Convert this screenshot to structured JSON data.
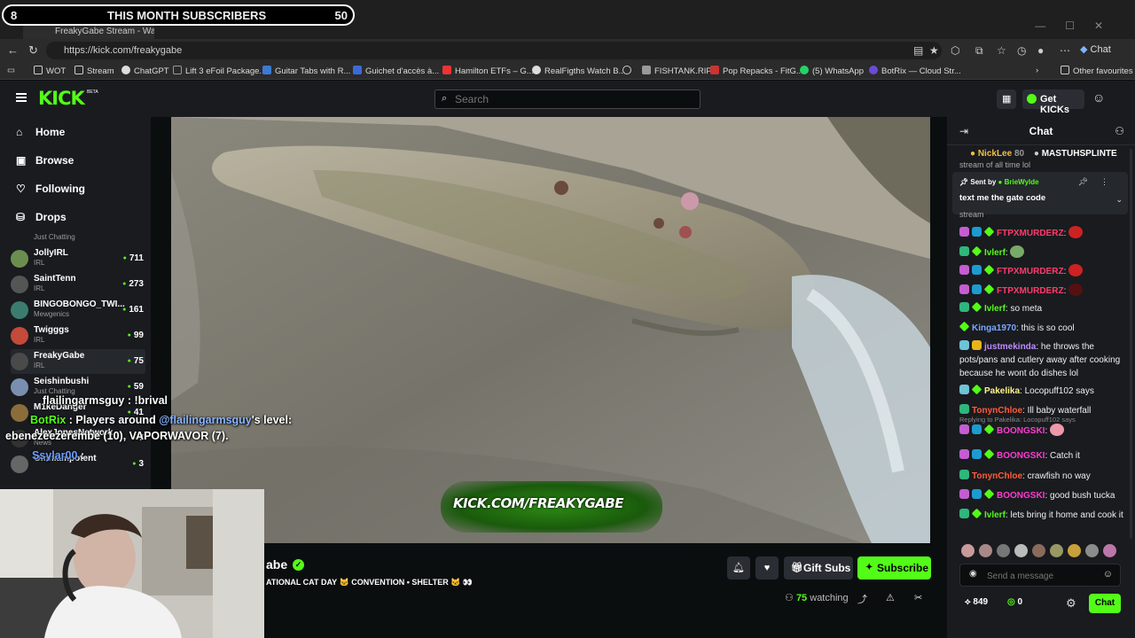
{
  "overlay_counter": {
    "count": "8",
    "title": "THIS MONTH SUBSCRIBERS",
    "value": "50"
  },
  "browser": {
    "tab_title": "FreakyGabe Stream - Watch",
    "url": "https://kick.com/freakygabe",
    "copilot_label": "Chat",
    "bookmarks": [
      "WOT",
      "Stream",
      "ChatGPT",
      "Lift 3 eFoil Package...",
      "Guitar Tabs with R...",
      "Guichet d'accès à...",
      "Hamilton ETFs – G...",
      "RealFigths Watch B...",
      "FISHTANK.RIP",
      "Pop Repacks - FitG...",
      "(5) WhatsApp",
      "BotRix — Cloud Str..."
    ],
    "other_favourites": "Other favourites"
  },
  "kick": {
    "logo": "KICK",
    "beta": "BETA",
    "search_placeholder": "Search",
    "get_kicks": "Get KICKs"
  },
  "sidebar": {
    "nav": [
      "Home",
      "Browse",
      "Following",
      "Drops"
    ],
    "top_category": "Just Chatting",
    "channels": [
      {
        "name": "JollyIRL",
        "category": "IRL",
        "viewers": "711",
        "color": "#6b8e4e"
      },
      {
        "name": "SaintTenn",
        "category": "IRL",
        "viewers": "273",
        "color": "#555"
      },
      {
        "name": "BINGOBONGO_TWI...",
        "category": "Mewgenics",
        "viewers": "161",
        "color": "#3a7d6f"
      },
      {
        "name": "Twigggs",
        "category": "IRL",
        "viewers": "99",
        "color": "#c44a3a"
      },
      {
        "name": "FreakyGabe",
        "category": "IRL",
        "viewers": "75",
        "color": "#4a4a4a"
      },
      {
        "name": "Seishinbushi",
        "category": "Just Chatting",
        "viewers": "59",
        "color": "#7a8fb0"
      },
      {
        "name": "M1keDanger",
        "category": "",
        "viewers": "41",
        "color": "#8a6d3b"
      },
      {
        "name": "AlexJonesNetwork",
        "category": "News",
        "viewers": "7",
        "color": "#333"
      },
      {
        "name": "Omniampotent",
        "category": "",
        "viewers": "3",
        "color": "#666"
      }
    ]
  },
  "overlay_chat": {
    "line1_user": "flailingarmsguy",
    "line1_msg": " : !brival",
    "line2_user": "BotRix",
    "line2_msg": " : Players around ",
    "line2_mention": "@flailingarmsguy",
    "line2_end": "'s level:",
    "line3": "ebenezeezerembe (10), VAPORWAVOR (7).",
    "line4_user": "Ssylar00",
    "line4_msg": " :"
  },
  "video": {
    "watermark": "KICK.COM/FREAKYGABE"
  },
  "stream": {
    "title": "abe",
    "subtitle": "ATIONAL CAT DAY 🐱 CONVENTION • SHELTER 🐱 👀",
    "gift_subs": "Gift Subs",
    "subscribe": "Subscribe",
    "viewers": "75",
    "watching": "watching"
  },
  "chat": {
    "title": "Chat",
    "top_gifter_1": "NickLee",
    "top_gifter_1_count": "80",
    "top_gifter_2": "MASTUHSPLINTE",
    "partial_top": "stream of all time lol",
    "pinned_by_label": "Sent by",
    "pinned_by_user": "BrieWylde",
    "pinned_message": "text me the gate code",
    "partial_pinned": "stream",
    "messages": [
      {
        "user": "FTPXMURDERZ",
        "color": "#ff3b6b",
        "text": "",
        "badges": [
          "b-sub-pink",
          "b-mod",
          "b-vip"
        ],
        "emote": "#c22"
      },
      {
        "user": "Ivlerf",
        "color": "#53fc18",
        "text": "",
        "badges": [
          "b-sub-green",
          "b-vip"
        ],
        "emote": "#7a6"
      },
      {
        "user": "FTPXMURDERZ",
        "color": "#ff3b6b",
        "text": "",
        "badges": [
          "b-sub-pink",
          "b-mod",
          "b-vip"
        ],
        "emote": "#c22"
      },
      {
        "user": "FTPXMURDERZ",
        "color": "#ff3b6b",
        "text": "",
        "badges": [
          "b-sub-pink",
          "b-mod",
          "b-vip"
        ],
        "emote": "#511"
      },
      {
        "user": "Ivlerf",
        "color": "#53fc18",
        "text": "so meta",
        "badges": [
          "b-sub-green",
          "b-vip"
        ]
      },
      {
        "user": "Kinga1970",
        "color": "#7aa8ff",
        "text": "this is so cool",
        "badges": [
          "b-vip"
        ]
      },
      {
        "user": "justmekinda",
        "color": "#c08cff",
        "text": "he throws the pots/pans and cutlery away after cooking because he wont do dishes lol",
        "badges": [
          "b-og",
          "b-gold"
        ]
      },
      {
        "user": "Pakelika",
        "color": "#fff58a",
        "text": "Locopuff102 says",
        "badges": [
          "b-og",
          "b-vip"
        ]
      },
      {
        "user": "TonynChloe",
        "color": "#ff5c3b",
        "text": "Ill baby waterfall",
        "badges": [
          "b-sub-green"
        ]
      },
      {
        "user": "BOONGSKI",
        "color": "#ff3bd1",
        "text": "",
        "badges": [
          "b-sub-pink",
          "b-mod",
          "b-vip"
        ],
        "emote": "#e9a",
        "reply": "Replying to Pakelika: Locopuff102 says"
      },
      {
        "user": "BOONGSKI",
        "color": "#ff3bd1",
        "text": "Catch it",
        "badges": [
          "b-sub-pink",
          "b-mod",
          "b-vip"
        ]
      },
      {
        "user": "TonynChloe",
        "color": "#ff5c3b",
        "text": "crawfish no way",
        "badges": [
          "b-sub-green"
        ]
      },
      {
        "user": "BOONGSKI",
        "color": "#ff3bd1",
        "text": "good bush tucka",
        "badges": [
          "b-sub-pink",
          "b-mod",
          "b-vip"
        ]
      },
      {
        "user": "Ivlerf",
        "color": "#53fc18",
        "text": "lets bring it home and cook it",
        "badges": [
          "b-sub-green",
          "b-vip"
        ]
      }
    ],
    "send_placeholder": "Send a message",
    "kicks_balance": "849",
    "points": "0",
    "chat_button": "Chat"
  }
}
